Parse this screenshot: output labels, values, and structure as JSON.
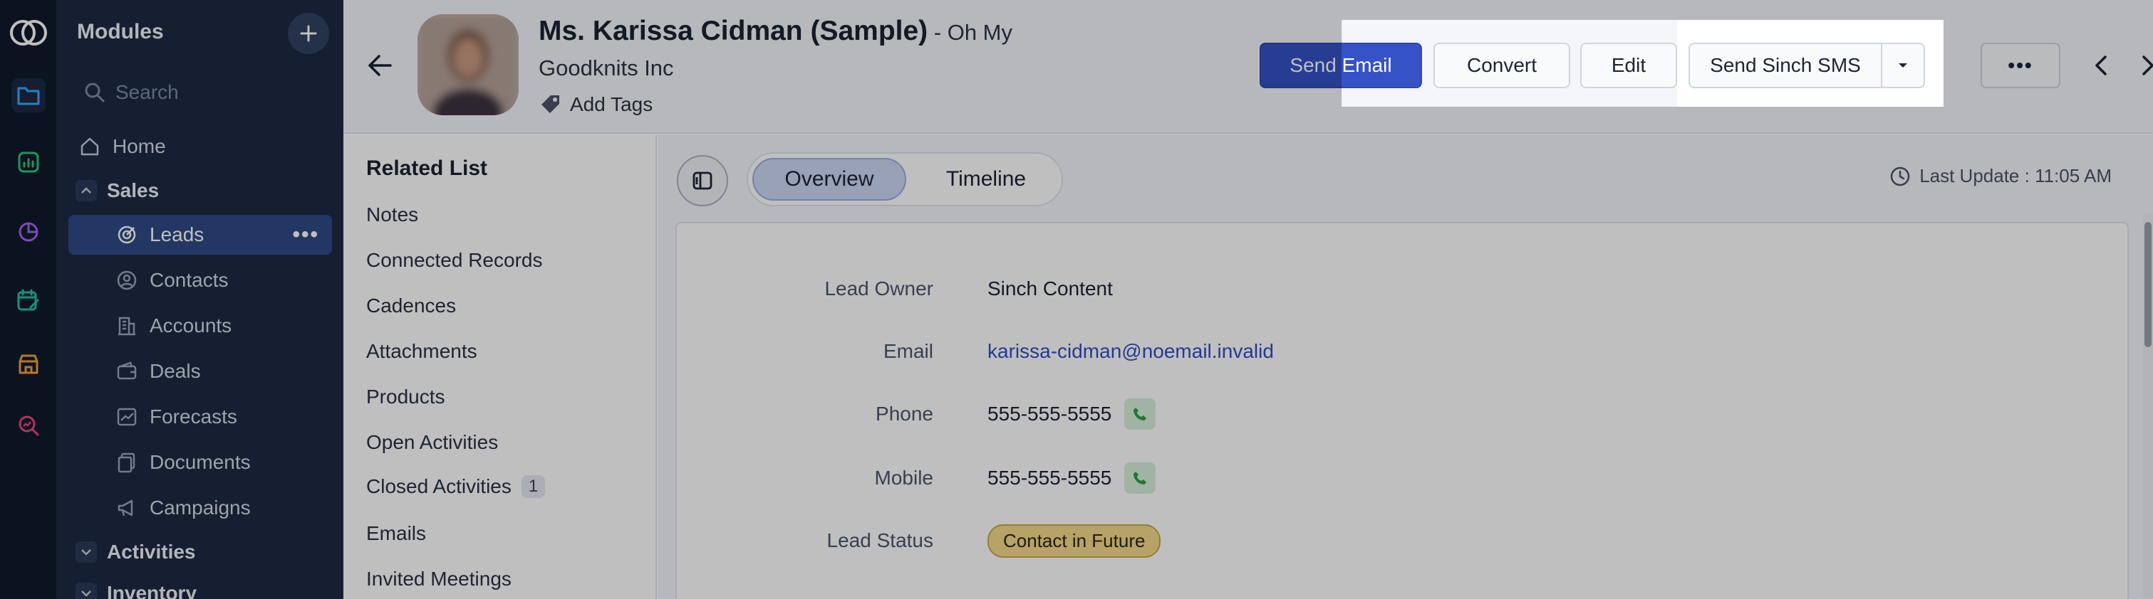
{
  "rail": {
    "icons": [
      "zoho-logo-icon",
      "folder-icon",
      "analytics-icon",
      "pie-chart-icon",
      "calendar-edit-icon",
      "store-icon",
      "search-analytics-icon"
    ]
  },
  "modules": {
    "title": "Modules",
    "search_placeholder": "Search",
    "home": "Home",
    "sales": "Sales",
    "items": [
      {
        "label": "Leads",
        "icon": "target-icon"
      },
      {
        "label": "Contacts",
        "icon": "contact-icon"
      },
      {
        "label": "Accounts",
        "icon": "building-icon"
      },
      {
        "label": "Deals",
        "icon": "wallet-icon"
      },
      {
        "label": "Forecasts",
        "icon": "trend-icon"
      },
      {
        "label": "Documents",
        "icon": "document-icon"
      },
      {
        "label": "Campaigns",
        "icon": "megaphone-icon"
      }
    ],
    "activities": "Activities",
    "inventory": "Inventory",
    "more_symbol": "•••"
  },
  "record": {
    "name": "Ms. Karissa Cidman (Sample)",
    "company_prefix": " - Oh My",
    "company_line2": "Goodknits Inc",
    "add_tags": "Add Tags"
  },
  "actions": {
    "send_email": "Send Email",
    "convert": "Convert",
    "edit": "Edit",
    "send_sms": "Send Sinch SMS",
    "more": "•••"
  },
  "related_list": {
    "title": "Related List",
    "items": [
      "Notes",
      "Connected Records",
      "Cadences",
      "Attachments",
      "Products",
      "Open Activities",
      "Closed Activities",
      "Emails",
      "Invited Meetings"
    ],
    "closed_activities_count": "1"
  },
  "tabs": {
    "overview": "Overview",
    "timeline": "Timeline"
  },
  "last_update": "Last Update : 11:05 AM",
  "fields": {
    "lead_owner_label": "Lead Owner",
    "lead_owner_value": "Sinch Content",
    "email_label": "Email",
    "email_value": "karissa-cidman@noemail.invalid",
    "phone_label": "Phone",
    "phone_value": "555-555-5555",
    "mobile_label": "Mobile",
    "mobile_value": "555-555-5555",
    "lead_status_label": "Lead Status",
    "lead_status_value": "Contact in Future"
  },
  "colors": {
    "primary_button": "#3552c6",
    "sidebar_bg": "#1d2a42",
    "rail_bg": "#0f1a2c",
    "status_pill": "#f4d88a",
    "link": "#2f4fc2"
  }
}
